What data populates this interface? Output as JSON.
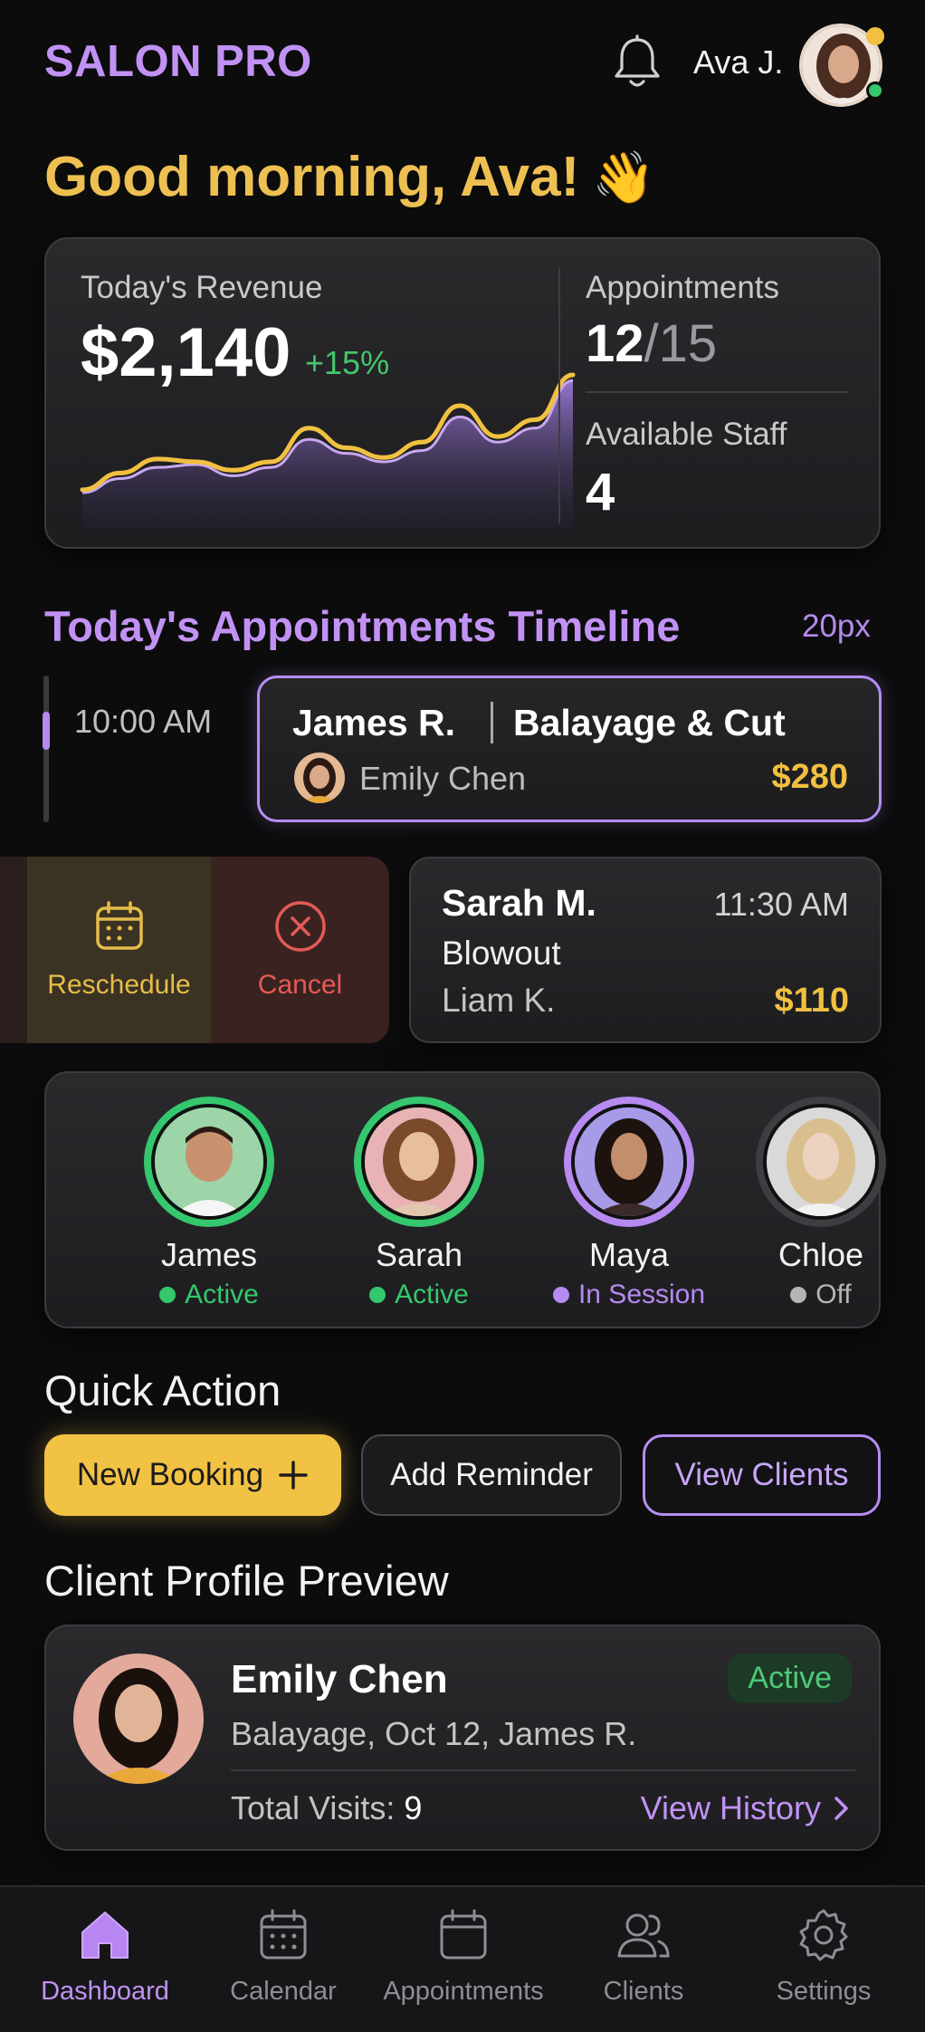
{
  "header": {
    "brand": "SALON PRO",
    "user_name": "Ava J.",
    "greeting": "Good morning, Ava!",
    "greeting_emoji": "👋"
  },
  "stats": {
    "revenue_label": "Today's Revenue",
    "revenue_value": "$2,140",
    "revenue_change": "+15%",
    "appointments_label": "Appointments",
    "appointments_done": "12",
    "appointments_slash": "/",
    "appointments_total": "15",
    "staff_label": "Available Staff",
    "staff_value": "4"
  },
  "chart_data": {
    "type": "area",
    "series": [
      {
        "values": [
          10,
          22,
          32,
          30,
          24,
          30,
          54,
          40,
          33,
          44,
          70,
          48,
          60,
          92
        ]
      },
      {
        "values": [
          8,
          18,
          26,
          28,
          20,
          26,
          46,
          36,
          30,
          38,
          62,
          44,
          54,
          88
        ]
      }
    ],
    "colors": {
      "line": "#f1c040",
      "area_top": "#9b7ad6",
      "area_bottom": "#2a2040"
    }
  },
  "timeline": {
    "title": "Today's Appointments Timeline",
    "extra": "20px",
    "first_time": "10:00 AM",
    "appointments": [
      {
        "client": "James R.",
        "service": "Balayage & Cut",
        "stylist": "Emily Chen",
        "price": "$280"
      },
      {
        "client": "Sarah M.",
        "time": "11:30 AM",
        "service": "Blowout",
        "stylist": "Liam K.",
        "price": "$110"
      }
    ],
    "swipe_actions": {
      "reschedule": "Reschedule",
      "cancel": "Cancel"
    }
  },
  "staff": [
    {
      "name": "James",
      "status": "Active",
      "status_color": "#35c76d",
      "ring_color": "#35c76d"
    },
    {
      "name": "Sarah",
      "status": "Active",
      "status_color": "#35c76d",
      "ring_color": "#35c76d"
    },
    {
      "name": "Maya",
      "status": "In Session",
      "status_color": "#b68af0",
      "ring_color": "#b68af0"
    },
    {
      "name": "Chloe",
      "status": "Off",
      "status_color": "#b5b5b5",
      "ring_color": "#3e3e42"
    }
  ],
  "quick_action": {
    "title": "Quick Action",
    "new_booking": "New Booking",
    "add_reminder": "Add Reminder",
    "view_clients": "View Clients"
  },
  "client_profile": {
    "title": "Client Profile Preview",
    "name": "Emily Chen",
    "badge": "Active",
    "meta": "Balayage, Oct 12, James R.",
    "visits_label": "Total Visits:",
    "visits_value": "9",
    "history_link": "View History"
  },
  "nav": {
    "items": [
      {
        "label": "Dashboard",
        "icon": "home-icon"
      },
      {
        "label": "Calendar",
        "icon": "calendar-icon"
      },
      {
        "label": "Appointments",
        "icon": "appointments-icon"
      },
      {
        "label": "Clients",
        "icon": "clients-icon"
      },
      {
        "label": "Settings",
        "icon": "settings-icon"
      }
    ]
  },
  "colors": {
    "accent_purple": "#c192f4",
    "accent_gold": "#f1c040",
    "active_green": "#35c76d",
    "cancel_red": "#e35a56"
  }
}
